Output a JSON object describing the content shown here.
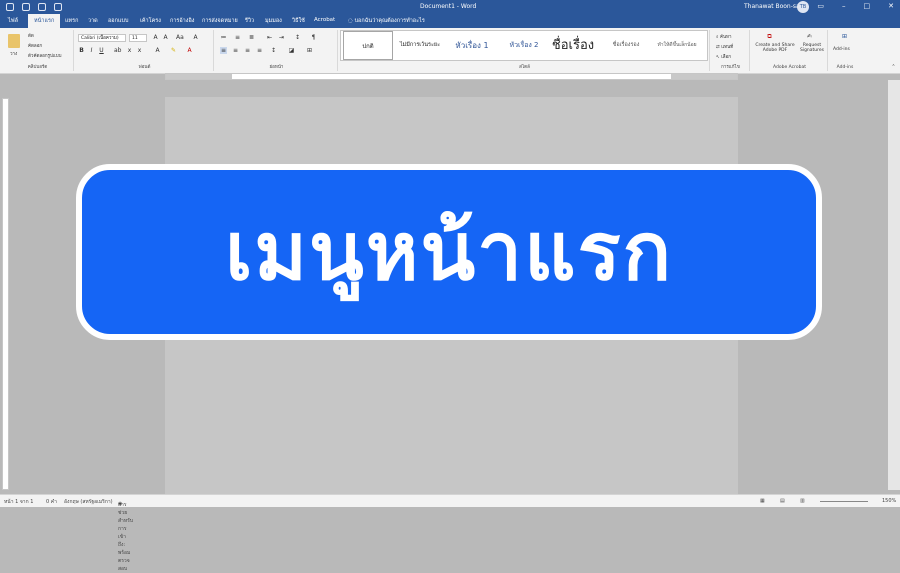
{
  "window": {
    "title": "Document1 - Word",
    "user": "Thanawat Boon-sak",
    "avatar_initials": "TB"
  },
  "tabs": [
    "ไฟล์",
    "หน้าแรก",
    "แทรก",
    "วาด",
    "ออกแบบ",
    "เค้าโครง",
    "การอ้างอิง",
    "การส่งจดหมาย",
    "รีวิว",
    "มุมมอง",
    "วิธีใช้",
    "Acrobat"
  ],
  "active_tab": "หน้าแรก",
  "tell_me": "บอกฉันว่าคุณต้องการทำอะไร",
  "ribbon": {
    "clipboard": {
      "paste": "วาง",
      "cut": "ตัด",
      "copy": "คัดลอก",
      "format_painter": "ตัวคัดลอกรูปแบบ",
      "label": "คลิปบอร์ด"
    },
    "font": {
      "name": "Calibri (เนื้อความ)",
      "size": "11",
      "label": "ฟอนต์"
    },
    "paragraph": {
      "label": "ย่อหน้า"
    },
    "styles": {
      "label": "สไตล์",
      "items": [
        "ปกติ",
        "ไม่มีการเว้นระยะ",
        "หัวเรื่อง 1",
        "หัวเรื่อง 2",
        "ชื่อเรื่อง",
        "ชื่อเรื่องรอง",
        "ทำให้ดีขึ้นเล็กน้อย"
      ]
    },
    "editing": {
      "find": "ค้นหา",
      "replace": "แทนที่",
      "select": "เลือก",
      "label": "การแก้ไข"
    },
    "acrobat": {
      "create_share": "Create and Share Adobe PDF",
      "request_sig": "Request Signatures",
      "label": "Adobe Acrobat"
    },
    "addins": {
      "button": "Add-ins",
      "label": "Add-ins"
    }
  },
  "status": {
    "page": "หน้า 1 จาก 1",
    "words": "0 คำ",
    "language": "อังกฤษ (สหรัฐอเมริกา)",
    "accessibility": "การช่วยสำหรับการเข้าถึง: พร้อมตรวจสอบ",
    "zoom": "150%"
  },
  "banner": {
    "text": "เมนูหน้าแรก"
  },
  "colors": {
    "accent": "#2b579a",
    "banner": "#1565f5"
  }
}
